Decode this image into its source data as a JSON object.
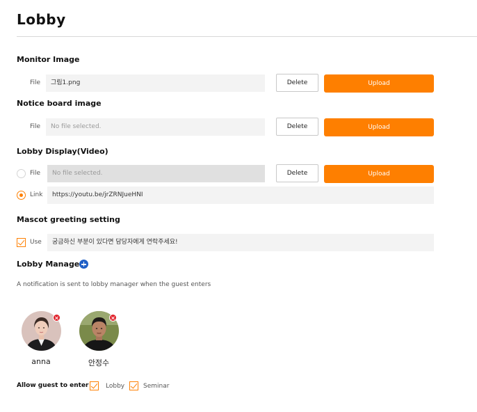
{
  "page": {
    "title": "Lobby"
  },
  "monitor_image": {
    "title": "Monitor Image",
    "file_label": "File",
    "file_value": "그림1.png",
    "delete_label": "Delete",
    "upload_label": "Upload"
  },
  "notice_board": {
    "title": "Notice board image",
    "file_label": "File",
    "file_placeholder": "No file selected.",
    "delete_label": "Delete",
    "upload_label": "Upload"
  },
  "lobby_display": {
    "title": "Lobby Display(Video)",
    "file_label": "File",
    "file_placeholder": "No file selected.",
    "delete_label": "Delete",
    "upload_label": "Upload",
    "link_label": "Link",
    "link_value": "https://youtu.be/jrZRNJueHNI",
    "selected_option": "Link"
  },
  "mascot": {
    "title": "Mascot greeting setting",
    "use_label": "Use",
    "use_checked": true,
    "message": "궁금하신 부분이 있다면 담당자에게 연락주세요!"
  },
  "lobby_manager": {
    "title": "Lobby Manager",
    "note": "A notification is sent to lobby manager when the guest enters",
    "managers": [
      {
        "name": "anna"
      },
      {
        "name": "안정수"
      }
    ]
  },
  "allow_guest": {
    "label": "Allow guest to enter",
    "options": [
      {
        "label": "Lobby",
        "checked": true
      },
      {
        "label": "Seminar",
        "checked": true
      }
    ]
  },
  "colors": {
    "accent": "#fe7f00",
    "add_button": "#1f5fc6",
    "remove_badge": "#e0222a"
  }
}
